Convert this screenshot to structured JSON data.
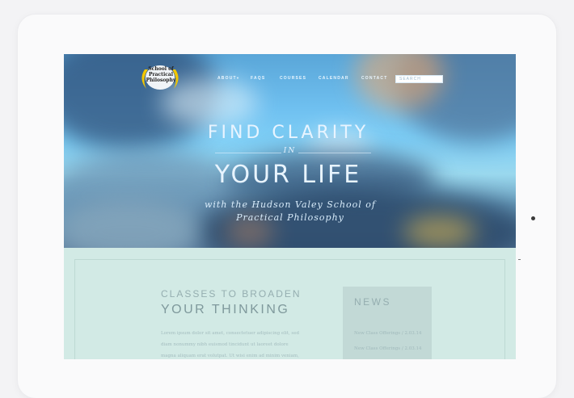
{
  "site": {
    "logo_text": "School of Practical Philosophy"
  },
  "nav": {
    "items": [
      "ABOUT",
      "FAQS",
      "COURSES",
      "CALENDAR",
      "CONTACT"
    ],
    "search_placeholder": "SEARCH"
  },
  "hero": {
    "line1": "FIND CLARITY",
    "line_in": "IN",
    "line2": "YOUR LIFE",
    "subtitle_1": "with the Hudson Valey School of",
    "subtitle_2": "Practical Philosophy"
  },
  "main": {
    "heading_1": "CLASSES TO BROADEN",
    "heading_2": "YOUR THINKING",
    "body_lines": [
      "Lorem ipsum dolor sit amet, consectetuer adipiscing elit, sed",
      "diam nonummy nibh euismod tincidunt ut laoreet dolore",
      "magna aliquam erat volutpat. Ut wisi enim ad minim veniam,"
    ]
  },
  "news": {
    "title": "NEWS",
    "items": [
      "New Class Offerings / 2.03.14",
      "New Class Offerings / 2.03.14"
    ]
  },
  "colors": {
    "sky": "#6fc0f0",
    "content_bg": "#d2eae5",
    "accent_gold": "#f2c600"
  }
}
